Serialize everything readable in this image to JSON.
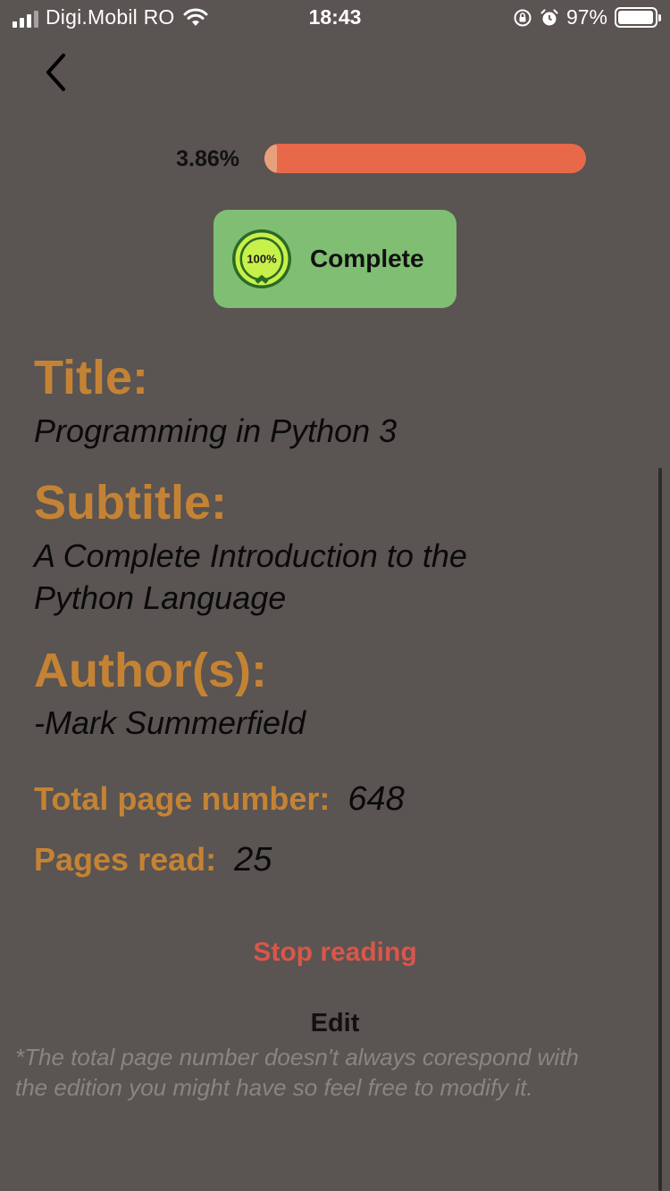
{
  "status_bar": {
    "carrier": "Digi.Mobil RO",
    "time": "18:43",
    "battery_percent": "97%",
    "battery_level": 0.97,
    "icons": [
      "signal-icon",
      "wifi-icon",
      "orientation-lock-icon",
      "alarm-icon",
      "battery-icon"
    ]
  },
  "nav": {
    "back_icon": "chevron-left-icon"
  },
  "progress": {
    "label": "3.86%",
    "fraction": 0.0386
  },
  "complete_button": {
    "icon_text": "100%",
    "label": "Complete"
  },
  "book": {
    "title_heading": "Title:",
    "title": "Programming in Python 3",
    "subtitle_heading": "Subtitle:",
    "subtitle_line1": "A Complete Introduction to the",
    "subtitle_line2": "Python Language",
    "authors_heading": "Author(s):",
    "author": "-Mark Summerfield",
    "total_pages_label": "Total page number:",
    "total_pages": "648",
    "pages_read_label": "Pages read:",
    "pages_read": "25"
  },
  "actions": {
    "stop_reading": "Stop reading",
    "edit": "Edit"
  },
  "footnote_line1": "*The total page number doesn't always corespond with",
  "footnote_line2": "the edition you might have so feel free to modify it.",
  "colors": {
    "background": "#5a5452",
    "accent": "#c48334",
    "progress": "#e8694a",
    "complete": "#80be73",
    "stop": "#d9574a"
  }
}
